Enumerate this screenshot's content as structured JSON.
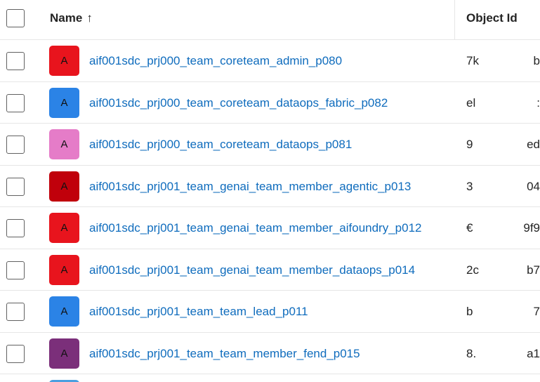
{
  "header": {
    "name_label": "Name",
    "sort_arrow": "↑",
    "object_id_label": "Object Id"
  },
  "rows": [
    {
      "avatar_letter": "A",
      "avatar_color": "#e8141d",
      "name": "aif001sdc_prj000_team_coreteam_admin_p080",
      "object_id_head": "7k",
      "object_id_tail": "b"
    },
    {
      "avatar_letter": "A",
      "avatar_color": "#2b83e6",
      "name": "aif001sdc_prj000_team_coreteam_dataops_fabric_p082",
      "object_id_head": "el",
      "object_id_tail": ":"
    },
    {
      "avatar_letter": "A",
      "avatar_color": "#e57cc8",
      "name": "aif001sdc_prj000_team_coreteam_dataops_p081",
      "object_id_head": "9",
      "object_id_tail": "ed"
    },
    {
      "avatar_letter": "A",
      "avatar_color": "#c0000b",
      "name": "aif001sdc_prj001_team_genai_team_member_agentic_p013",
      "object_id_head": "3",
      "object_id_tail": "04"
    },
    {
      "avatar_letter": "A",
      "avatar_color": "#e8141d",
      "name": "aif001sdc_prj001_team_genai_team_member_aifoundry_p012",
      "object_id_head": "€",
      "object_id_tail": "9f9"
    },
    {
      "avatar_letter": "A",
      "avatar_color": "#e8141d",
      "name": "aif001sdc_prj001_team_genai_team_member_dataops_p014",
      "object_id_head": "2c",
      "object_id_tail": "b7"
    },
    {
      "avatar_letter": "A",
      "avatar_color": "#2b83e6",
      "name": "aif001sdc_prj001_team_team_lead_p011",
      "object_id_head": "b",
      "object_id_tail": "7"
    },
    {
      "avatar_letter": "A",
      "avatar_color": "#7b2f7a",
      "name": "aif001sdc_prj001_team_team_member_fend_p015",
      "object_id_head": "8.",
      "object_id_tail": "a1"
    }
  ]
}
